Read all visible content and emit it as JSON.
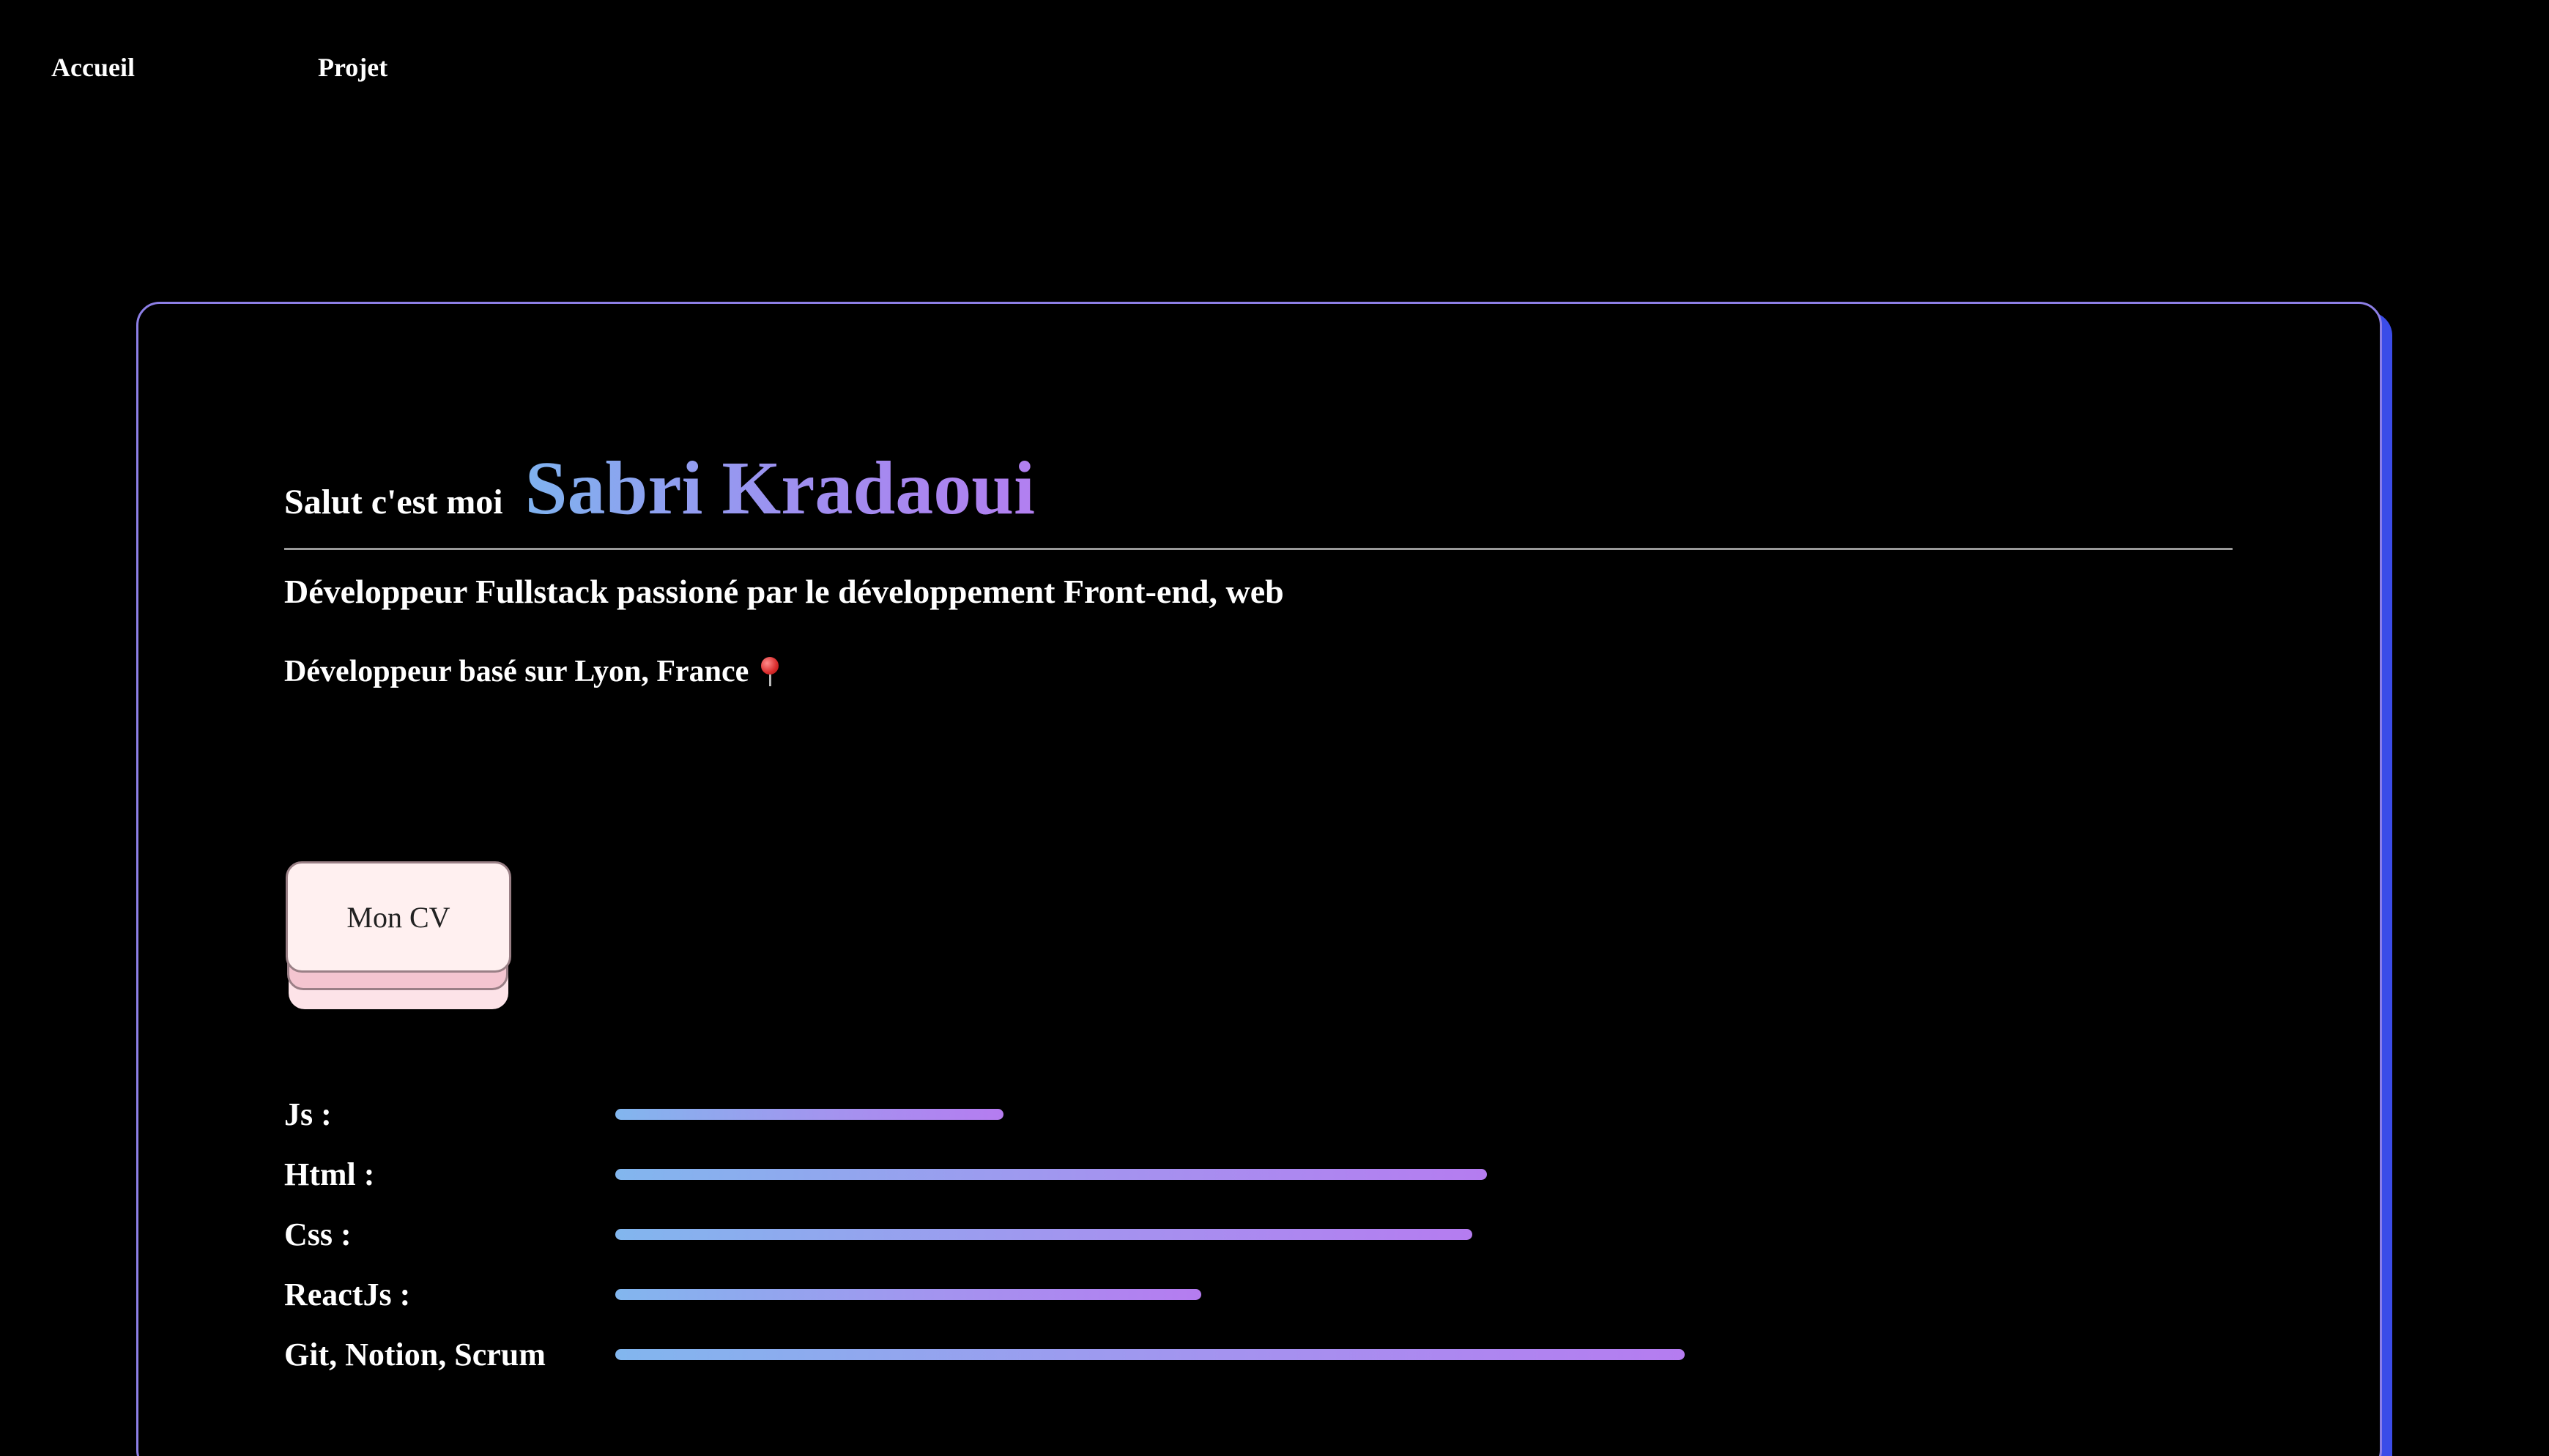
{
  "nav": {
    "home": "Accueil",
    "project": "Projet"
  },
  "hero": {
    "greeting": "Salut c'est moi",
    "name": "Sabri Kradaoui",
    "subtitle": "Développeur Fullstack passioné par le développement Front-end, web",
    "location": "Développeur basé sur Lyon, France",
    "location_icon": "pin-icon"
  },
  "cv_button": {
    "label": "Mon CV"
  },
  "skills": [
    {
      "label": "Js :",
      "level": 0.53
    },
    {
      "label": "Html :",
      "level": 1.19
    },
    {
      "label": "Css :",
      "level": 1.17
    },
    {
      "label": "ReactJs :",
      "level": 0.8
    },
    {
      "label": "Git, Notion, Scrum",
      "level": 1.46
    }
  ],
  "colors": {
    "background": "#000000",
    "card_border": "#8d7fe6",
    "card_shadow": "#3b4ce8",
    "gradient_start": "#7fb2ef",
    "gradient_end": "#b27ff0",
    "cv_button_bg": "#fff0f0"
  }
}
